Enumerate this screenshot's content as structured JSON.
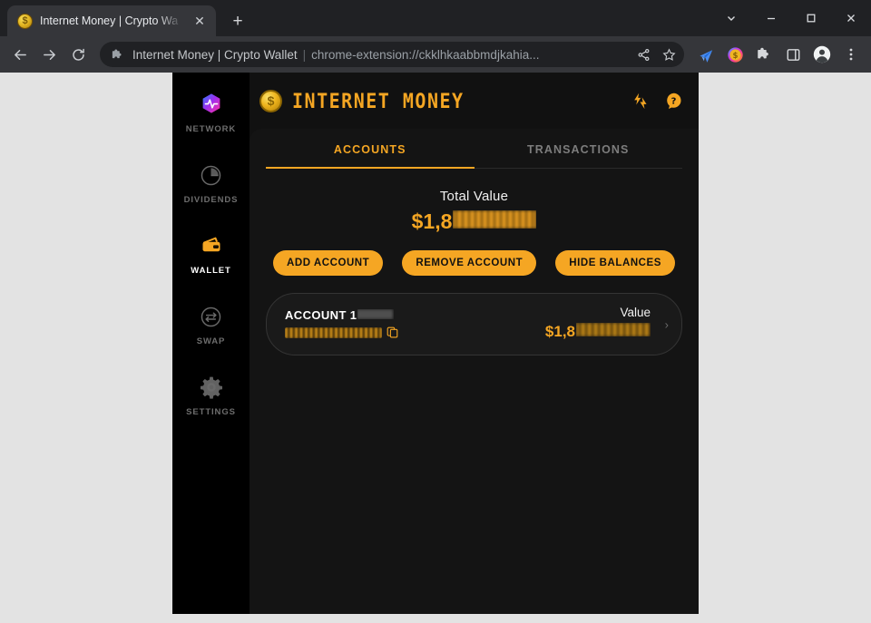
{
  "browser": {
    "tab": {
      "title": "Internet Money | Crypto Wa",
      "favicon_icon": "gold-coin-icon",
      "close_icon": "✕"
    },
    "new_tab_icon": "+",
    "window_controls": {
      "tab_search_icon": "⌄",
      "minimize_icon": "—",
      "maximize_icon": "▢",
      "close_icon": "✕"
    },
    "nav": {
      "back_icon": "←",
      "forward_icon": "→",
      "reload_icon": "⟳"
    },
    "omnibox": {
      "extension_icon": "puzzle-piece-icon",
      "site_name": "Internet Money | Crypto Wallet",
      "separator": "|",
      "url": "chrome-extension://ckklhkaabbmdjkahia...",
      "share_icon": "share-icon",
      "bookmark_icon": "star-icon"
    },
    "toolbar_icons": [
      "plane-icon",
      "coin-extension-icon",
      "extensions-puzzle-icon",
      "side-panel-icon",
      "profile-avatar-icon",
      "three-dot-menu-icon"
    ]
  },
  "extension": {
    "sidebar": {
      "items": [
        {
          "label": "NETWORK",
          "icon": "network-hexagon-icon",
          "active": false
        },
        {
          "label": "DIVIDENDS",
          "icon": "pie-chart-icon",
          "active": false
        },
        {
          "label": "WALLET",
          "icon": "wallet-icon",
          "active": true
        },
        {
          "label": "SWAP",
          "icon": "swap-arrows-icon",
          "active": false
        },
        {
          "label": "SETTINGS",
          "icon": "gear-icon",
          "active": false
        }
      ]
    },
    "header": {
      "logo_icon": "gold-coin-icon",
      "title": "INTERNET MONEY",
      "lightning_icon": "lightning-bolt-icon",
      "help_icon": "help-question-icon"
    },
    "tabs": [
      {
        "label": "ACCOUNTS",
        "active": true
      },
      {
        "label": "TRANSACTIONS",
        "active": false
      }
    ],
    "total": {
      "label": "Total Value",
      "value_prefix": "$1,8",
      "value_redacted": true
    },
    "actions": [
      {
        "label": "ADD ACCOUNT"
      },
      {
        "label": "REMOVE ACCOUNT"
      },
      {
        "label": "HIDE BALANCES"
      }
    ],
    "account": {
      "name": "ACCOUNT 1",
      "name_redacted": true,
      "address_redacted": true,
      "copy_icon": "copy-icon",
      "value_label": "Value",
      "value_prefix": "$1,8",
      "value_redacted": true,
      "chevron_icon": "›"
    }
  },
  "colors": {
    "accent": "#f5a623",
    "panel_bg": "#141414",
    "sidebar_bg": "#000000",
    "ext_bg": "#111111",
    "page_bg": "#e3e3e3"
  }
}
